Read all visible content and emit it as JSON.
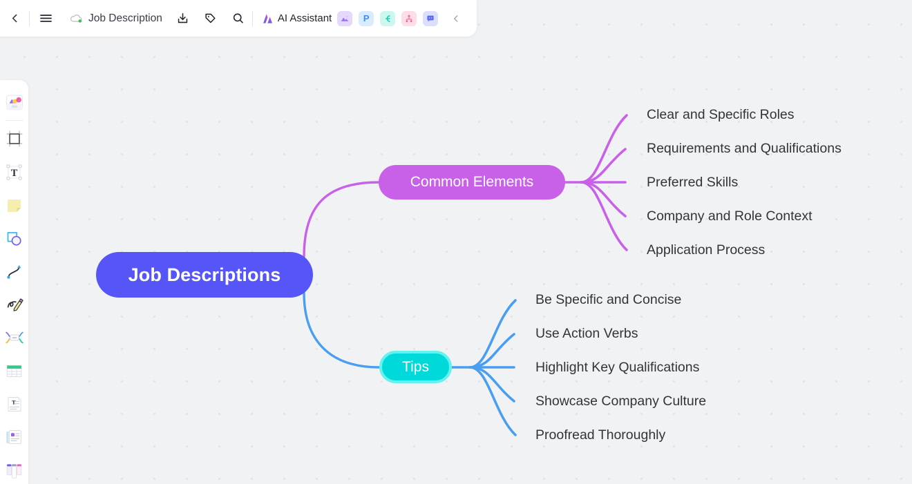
{
  "header": {
    "back_icon": "chevron-left-icon",
    "menu_icon": "hamburger-menu-icon",
    "cloud_icon": "cloud-saved-icon",
    "doc_title": "Job Description",
    "download_icon": "download-icon",
    "tag_icon": "tag-icon",
    "search_icon": "search-icon",
    "ai_label": "AI Assistant",
    "ai_logo_icon": "ai-logo-icon",
    "collapse_icon": "chevron-left-icon",
    "apps": [
      {
        "name": "image-app-icon",
        "glyph": "⛰",
        "bg": "#e5d8fb",
        "fg": "#9b6ef0"
      },
      {
        "name": "presentation-app-icon",
        "glyph": "P",
        "bg": "#d9ecff",
        "fg": "#3b8efc"
      },
      {
        "name": "mindmap-app-icon",
        "glyph": "⟨",
        "bg": "#cdf6ef",
        "fg": "#14c9b0"
      },
      {
        "name": "flowchart-app-icon",
        "glyph": "∴",
        "bg": "#ffdde6",
        "fg": "#f0608a"
      },
      {
        "name": "comment-app-icon",
        "glyph": "■",
        "bg": "#dcdffc",
        "fg": "#5c6bf0"
      }
    ]
  },
  "toolrail": {
    "items": [
      {
        "name": "templates-tool",
        "label": "Templates"
      },
      {
        "name": "frame-tool",
        "label": "Frame"
      },
      {
        "name": "text-tool",
        "label": "Text"
      },
      {
        "name": "sticky-note-tool",
        "label": "Sticky Note"
      },
      {
        "name": "shapes-tool",
        "label": "Shapes"
      },
      {
        "name": "connector-tool",
        "label": "Connector"
      },
      {
        "name": "pen-tool",
        "label": "Pen"
      },
      {
        "name": "mindmap-tool",
        "label": "Mind Map"
      },
      {
        "name": "table-tool",
        "label": "Table"
      },
      {
        "name": "document-tool",
        "label": "Document"
      },
      {
        "name": "card-tool",
        "label": "Card"
      },
      {
        "name": "kanban-tool",
        "label": "Kanban"
      }
    ]
  },
  "mindmap": {
    "root": {
      "label": "Job Descriptions",
      "color": "#5555f8"
    },
    "branches": [
      {
        "label": "Common Elements",
        "color": "#c961e8",
        "selected": false,
        "children": [
          "Clear and Specific Roles",
          "Requirements and Qualifications",
          "Preferred Skills",
          "Company and Role Context",
          "Application Process"
        ]
      },
      {
        "label": "Tips",
        "color": "#00d9d9",
        "selected": true,
        "children": [
          "Be Specific and Concise",
          "Use Action Verbs",
          "Highlight Key Qualifications",
          "Showcase Company Culture",
          "Proofread Thoroughly"
        ]
      }
    ]
  }
}
